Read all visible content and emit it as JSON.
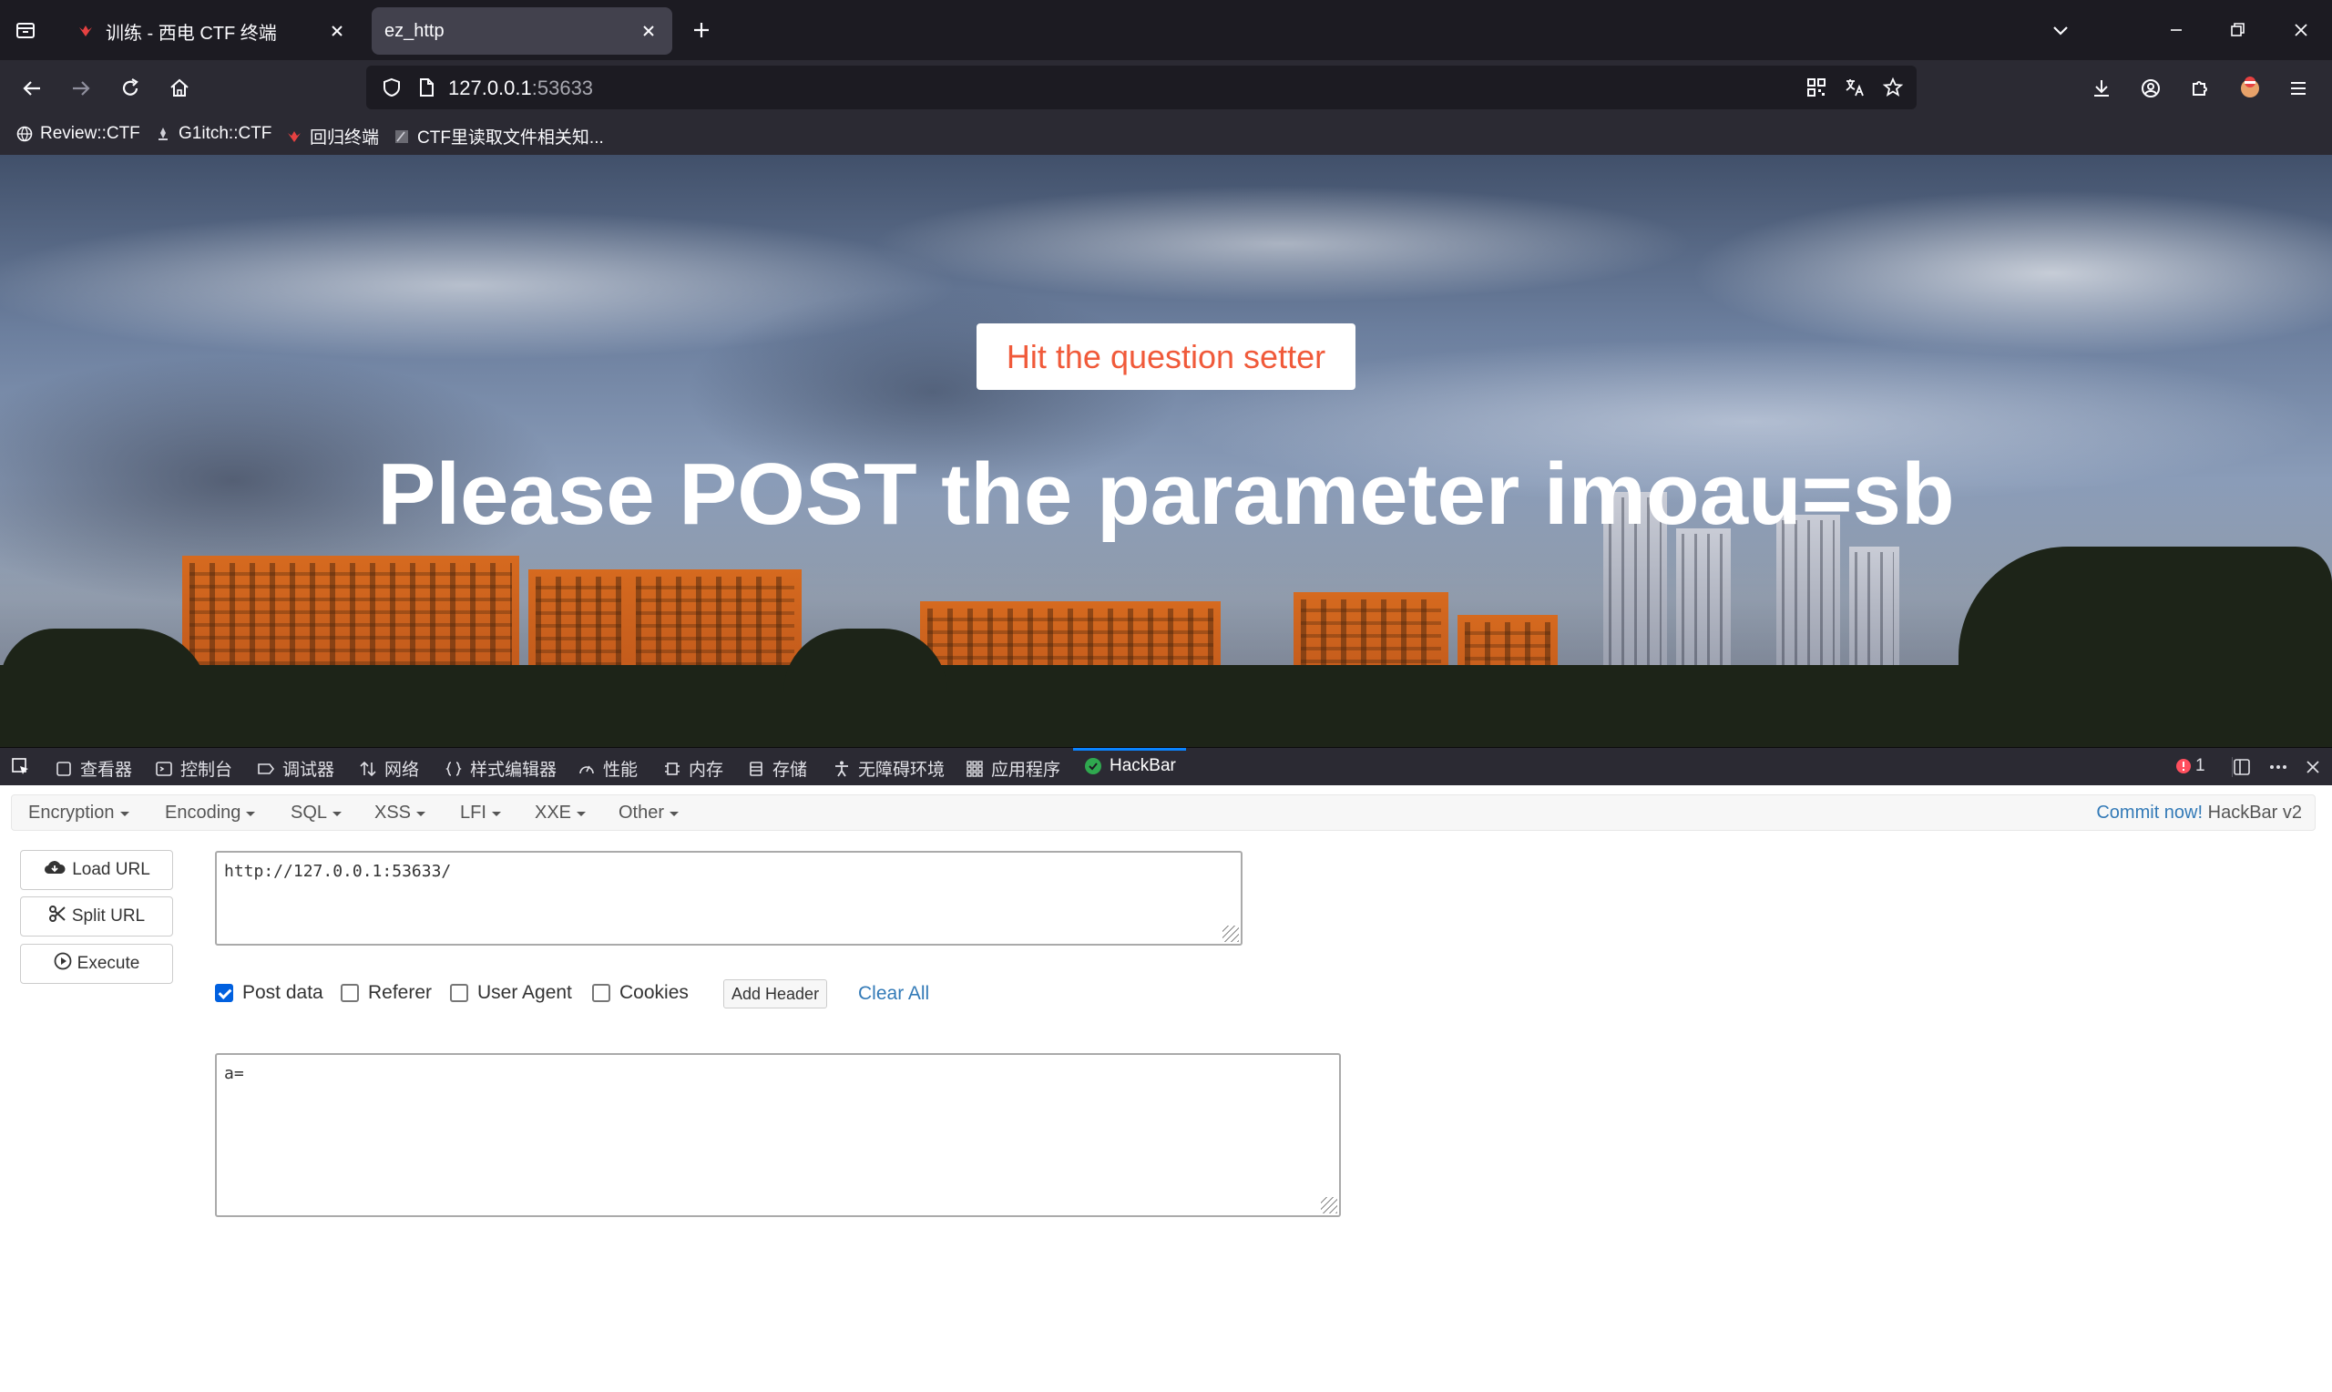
{
  "browser": {
    "tabs": [
      {
        "title": "训练 - 西电 CTF 终端",
        "active": false
      },
      {
        "title": "ez_http",
        "active": true
      }
    ],
    "url": {
      "host": "127.0.0.1",
      "port": ":53633"
    },
    "bookmarks": [
      "Review::CTF",
      "G1itch::CTF",
      "回归终端",
      "CTF里读取文件相关知..."
    ]
  },
  "page": {
    "button_label": "Hit the question setter",
    "headline": "Please POST the parameter imoau=sb"
  },
  "devtools": {
    "tools": [
      "查看器",
      "控制台",
      "调试器",
      "网络",
      "样式编辑器",
      "性能",
      "内存",
      "存储",
      "无障碍环境",
      "应用程序",
      "HackBar"
    ],
    "error_count": "1"
  },
  "hackbar": {
    "menu": [
      "Encryption",
      "Encoding",
      "SQL",
      "XSS",
      "LFI",
      "XXE",
      "Other"
    ],
    "commit_link": "Commit now!",
    "version": "HackBar v2",
    "buttons": {
      "load": "Load URL",
      "split": "Split URL",
      "execute": "Execute"
    },
    "url_value": "http://127.0.0.1:53633/",
    "options": [
      {
        "label": "Post data",
        "checked": true
      },
      {
        "label": "Referer",
        "checked": false
      },
      {
        "label": "User Agent",
        "checked": false
      },
      {
        "label": "Cookies",
        "checked": false
      }
    ],
    "add_header": "Add Header",
    "clear_all": "Clear All",
    "post_value": "a="
  },
  "colors": {
    "accent": "#0a84ff",
    "button_text": "#f05a3a",
    "link": "#337ab7"
  }
}
